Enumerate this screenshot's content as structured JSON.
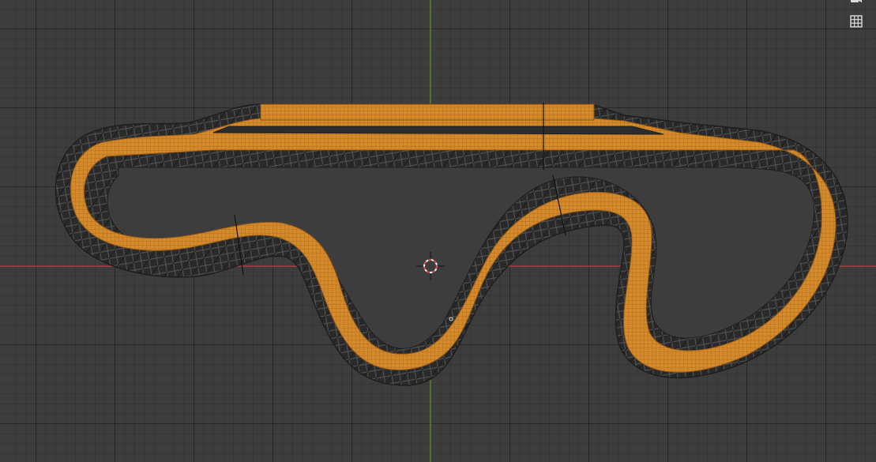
{
  "app": {
    "viewport_mode": "top-orthographic",
    "colors": {
      "background": "#3d3d3d",
      "grid_minor": "#383838",
      "grid_major": "#2e2e2e",
      "x_axis": "#c8404d",
      "y_axis": "#6e9a2a",
      "track_surface": "#d48a2b",
      "track_wire": "#a8661a",
      "curb_dark": "#262626",
      "curb_light": "#5a5a5a",
      "cursor_red": "#e04a4a",
      "cursor_white": "#ffffff",
      "icon": "#dcdcdc"
    }
  },
  "overlays": {
    "camera": {
      "icon": "camera-icon"
    },
    "grid_toggle": {
      "icon": "grid-icon"
    }
  }
}
